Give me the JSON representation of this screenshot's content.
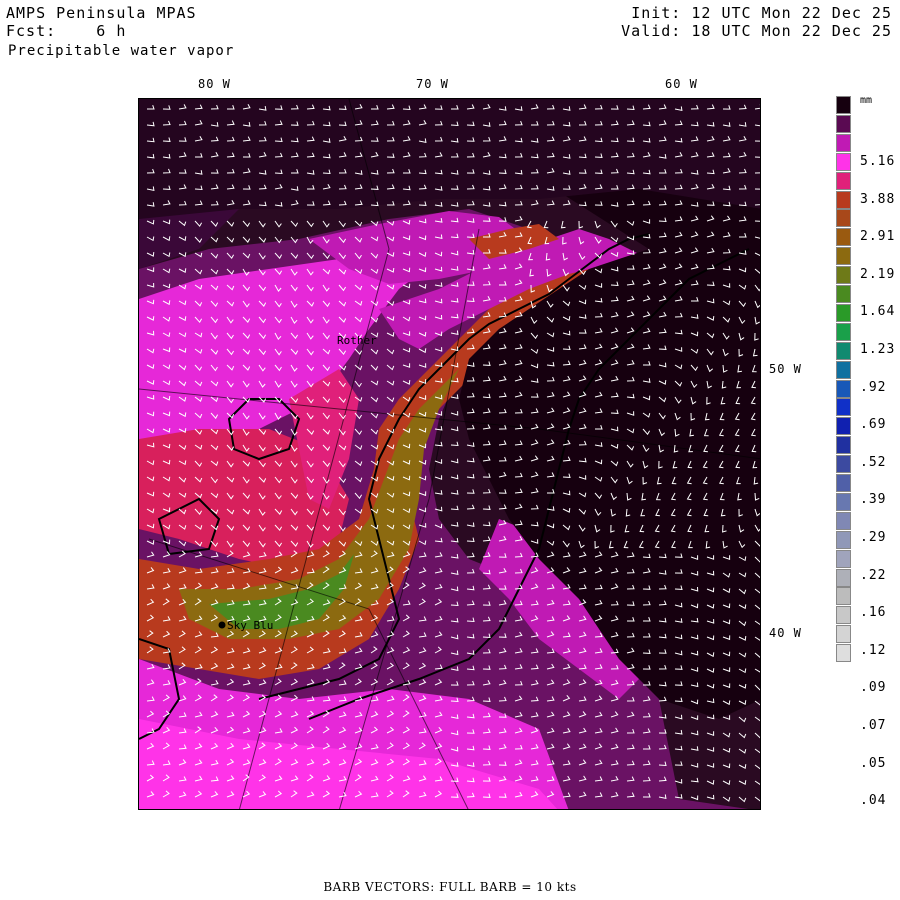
{
  "header": {
    "title": "AMPS Peninsula MPAS",
    "forecast_label": "Fcst:",
    "forecast_value": "6 h",
    "field": "Precipitable water vapor",
    "init": "Init: 12 UTC Mon 22 Dec 25",
    "valid": "Valid: 18 UTC Mon 22 Dec 25"
  },
  "axes": {
    "longitude_labels": [
      "80 W",
      "70 W",
      "60 W"
    ],
    "latitude_labels": [
      "50 W",
      "40 W"
    ]
  },
  "map": {
    "stations": [
      {
        "name": "Rother"
      },
      {
        "name": "Sky Blu"
      }
    ],
    "barb_color": "#ffffff",
    "coast_color": "#000000"
  },
  "legend": {
    "units": "mm",
    "labels": [
      "5.16",
      "3.88",
      "2.91",
      "2.19",
      "1.64",
      "1.23",
      ".92",
      ".69",
      ".52",
      ".39",
      ".29",
      ".22",
      ".16",
      ".12",
      ".09",
      ".07",
      ".05",
      ".04"
    ],
    "colors": [
      "#16000f",
      "#5a0a52",
      "#c01ab4",
      "#ff33e8",
      "#e0207a",
      "#b83a1e",
      "#a8481a",
      "#9a5a10",
      "#8c6a10",
      "#6e7a18",
      "#4a8a20",
      "#2a9a28",
      "#1aa04a",
      "#108a70",
      "#1070a0",
      "#1858b8",
      "#1030c8",
      "#1020b0",
      "#2030a0",
      "#3c4aa0",
      "#5060a8",
      "#6878b0",
      "#8088b4",
      "#9098b8",
      "#a0a4bc",
      "#aeb0b8",
      "#bcbcbc",
      "#c8c8c8",
      "#d4d4d4",
      "#dedede"
    ]
  },
  "footer": "BARB VECTORS:  FULL BARB = 10 kts"
}
